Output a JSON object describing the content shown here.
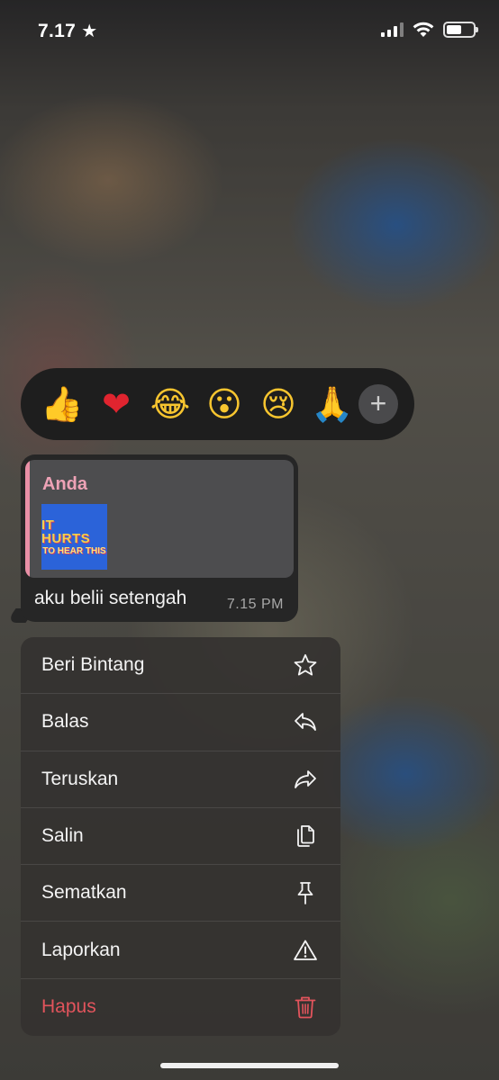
{
  "status_bar": {
    "time": "7.17",
    "time_star": "★"
  },
  "reactions": {
    "emojis": [
      {
        "name": "thumbs-up",
        "glyph": "👍"
      },
      {
        "name": "red-heart",
        "glyph": "❤"
      },
      {
        "name": "tears-of-joy",
        "glyph": "😂"
      },
      {
        "name": "surprised-face",
        "glyph": "😮"
      },
      {
        "name": "crying-face",
        "glyph": "😢"
      },
      {
        "name": "folded-hands",
        "glyph": "🙏"
      }
    ],
    "more_label": "+"
  },
  "message": {
    "quote_author": "Anda",
    "quote_thumbnail_text_line1": "IT HURTS",
    "quote_thumbnail_text_line2": "TO HEAR THIS",
    "text": "aku belii setengah",
    "time": "7.15 PM"
  },
  "menu": {
    "items": [
      {
        "label": "Beri Bintang",
        "icon": "star-icon"
      },
      {
        "label": "Balas",
        "icon": "reply-icon"
      },
      {
        "label": "Teruskan",
        "icon": "forward-icon"
      },
      {
        "label": "Salin",
        "icon": "copy-icon"
      },
      {
        "label": "Sematkan",
        "icon": "pin-icon"
      },
      {
        "label": "Laporkan",
        "icon": "warning-icon"
      },
      {
        "label": "Hapus",
        "icon": "trash-icon"
      }
    ]
  },
  "colors": {
    "quote_author": "#eea2b6",
    "danger": "#e2545c",
    "reaction_bar_bg": "#1e1e1e",
    "bubble_bg": "#262626"
  }
}
